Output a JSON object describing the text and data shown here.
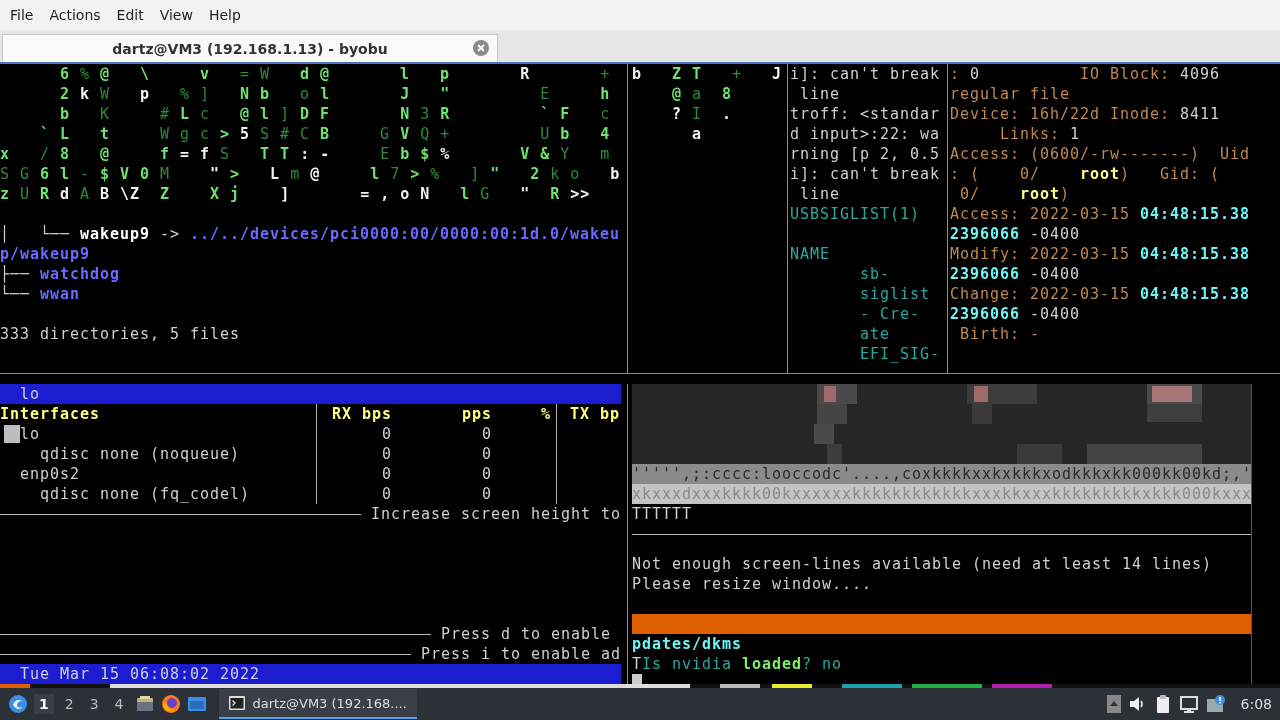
{
  "menu": [
    "File",
    "Actions",
    "Edit",
    "View",
    "Help"
  ],
  "tabs": [
    {
      "label": "dartz@VM3 (192.168.1.13) - byobu",
      "selected": true
    }
  ],
  "top": {
    "matrix_left": [
      [
        {
          "text": "      6",
          "kind": "bright"
        },
        {
          "text": " %",
          "kind": "dim"
        },
        {
          "text": " @",
          "kind": "bright"
        },
        {
          "text": "   \\",
          "kind": "bright"
        },
        {
          "text": "     v",
          "kind": "bright"
        },
        {
          "text": "   = W",
          "kind": "dim"
        },
        {
          "text": "   d @",
          "kind": "bright"
        },
        {
          "text": "       l   p",
          "kind": "bright"
        },
        {
          "text": "       R",
          "kind": "white"
        },
        {
          "text": "       +",
          "kind": "dim"
        }
      ],
      [
        {
          "text": "      2",
          "kind": "bright"
        },
        {
          "text": " k",
          "kind": "white"
        },
        {
          "text": " W",
          "kind": "dim"
        },
        {
          "text": "   p",
          "kind": "white"
        },
        {
          "text": "   %",
          "kind": "dim"
        },
        {
          "text": " ]",
          "kind": "dim"
        },
        {
          "text": "   N b",
          "kind": "bright"
        },
        {
          "text": "   o",
          "kind": "dim"
        },
        {
          "text": " l",
          "kind": "bright"
        },
        {
          "text": "       J   \"",
          "kind": "bright"
        },
        {
          "text": "         E",
          "kind": "dim"
        },
        {
          "text": "     h",
          "kind": "bright"
        }
      ],
      [
        {
          "text": "      b",
          "kind": "bright"
        },
        {
          "text": "   K",
          "kind": "dim"
        },
        {
          "text": "     #",
          "kind": "dim"
        },
        {
          "text": " L",
          "kind": "bright"
        },
        {
          "text": " c",
          "kind": "dim"
        },
        {
          "text": "   @ l",
          "kind": "bright"
        },
        {
          "text": " ]",
          "kind": "dim"
        },
        {
          "text": " D F",
          "kind": "bright"
        },
        {
          "text": "       N",
          "kind": "bright"
        },
        {
          "text": " 3",
          "kind": "dim"
        },
        {
          "text": " R",
          "kind": "bright"
        },
        {
          "text": "         ` F",
          "kind": "bright"
        },
        {
          "text": "   c",
          "kind": "dim"
        }
      ],
      [
        {
          "text": "    ` L",
          "kind": "bright"
        },
        {
          "text": "   t",
          "kind": "bright"
        },
        {
          "text": "     W g c",
          "kind": "dim"
        },
        {
          "text": " >",
          "kind": "bright"
        },
        {
          "text": " 5",
          "kind": "white"
        },
        {
          "text": " S # C",
          "kind": "dim"
        },
        {
          "text": " B",
          "kind": "bright"
        },
        {
          "text": "     G",
          "kind": "dim"
        },
        {
          "text": " V",
          "kind": "bright"
        },
        {
          "text": " Q +",
          "kind": "dim"
        },
        {
          "text": "         U",
          "kind": "dim"
        },
        {
          "text": " b",
          "kind": "bright"
        },
        {
          "text": "   4",
          "kind": "bright"
        }
      ],
      [
        {
          "text": "x",
          "kind": "bright"
        },
        {
          "text": "   /",
          "kind": "dim"
        },
        {
          "text": " 8",
          "kind": "bright"
        },
        {
          "text": "   @",
          "kind": "bright"
        },
        {
          "text": "     f",
          "kind": "bright"
        },
        {
          "text": " = f",
          "kind": "white"
        },
        {
          "text": " S",
          "kind": "dim"
        },
        {
          "text": "   T T",
          "kind": "bright"
        },
        {
          "text": " : -",
          "kind": "white"
        },
        {
          "text": "     E",
          "kind": "dim"
        },
        {
          "text": " b $",
          "kind": "bright"
        },
        {
          "text": " %",
          "kind": "white"
        },
        {
          "text": "       V &",
          "kind": "bright"
        },
        {
          "text": " Y",
          "kind": "dim"
        },
        {
          "text": "   m",
          "kind": "dim"
        }
      ],
      [
        {
          "text": "S G",
          "kind": "dim"
        },
        {
          "text": " 6 l",
          "kind": "bright"
        },
        {
          "text": " -",
          "kind": "dim"
        },
        {
          "text": " $ V 0",
          "kind": "bright"
        },
        {
          "text": " M",
          "kind": "dim"
        },
        {
          "text": "    \"",
          "kind": "white"
        },
        {
          "text": " >",
          "kind": "bright"
        },
        {
          "text": "   L",
          "kind": "white"
        },
        {
          "text": " m",
          "kind": "dim"
        },
        {
          "text": " @",
          "kind": "white"
        },
        {
          "text": "     l",
          "kind": "bright"
        },
        {
          "text": " 7",
          "kind": "dim"
        },
        {
          "text": " >",
          "kind": "bright"
        },
        {
          "text": " %",
          "kind": "dim"
        },
        {
          "text": "   ]",
          "kind": "dim"
        },
        {
          "text": " \"",
          "kind": "bright"
        },
        {
          "text": "   2",
          "kind": "bright"
        },
        {
          "text": " k o",
          "kind": "dim"
        },
        {
          "text": "   b",
          "kind": "white"
        }
      ],
      [
        {
          "text": "z",
          "kind": "bright"
        },
        {
          "text": " U",
          "kind": "dim"
        },
        {
          "text": " R",
          "kind": "bright"
        },
        {
          "text": " d",
          "kind": "white"
        },
        {
          "text": " A",
          "kind": "dim"
        },
        {
          "text": " B \\Z",
          "kind": "white"
        },
        {
          "text": "  Z",
          "kind": "bright"
        },
        {
          "text": "    X j",
          "kind": "bright"
        },
        {
          "text": "    ]",
          "kind": "white"
        },
        {
          "text": "       = , o N",
          "kind": "white"
        },
        {
          "text": "   l",
          "kind": "bright"
        },
        {
          "text": " G",
          "kind": "dim"
        },
        {
          "text": "   \"",
          "kind": "white"
        },
        {
          "text": "  R",
          "kind": "bright"
        },
        {
          "text": " >>",
          "kind": "white"
        }
      ]
    ],
    "tree": [
      [
        [
          {
            "text": "│   └── ",
            "kind": "gray"
          },
          {
            "text": "wakeup9",
            "kind": "bwhite"
          },
          {
            "text": " -> ",
            "kind": "gray"
          },
          {
            "text": "../../devices/pci0000:00/0000:00:1d.0/wakeu",
            "kind": "blue"
          }
        ],
        [
          {
            "text": "p/wakeup9",
            "kind": "blue"
          }
        ],
        [
          {
            "text": "├── ",
            "kind": "gray"
          },
          {
            "text": "watchdog",
            "kind": "blue"
          }
        ],
        [
          {
            "text": "└── ",
            "kind": "gray"
          },
          {
            "text": "wwan",
            "kind": "blue"
          }
        ]
      ],
      [
        [
          {
            "text": "333 directories, 5 files",
            "kind": "gray"
          }
        ]
      ]
    ],
    "matrix_right": [
      [
        {
          "text": "b",
          "kind": "white"
        },
        {
          "text": "   Z T",
          "kind": "bright"
        },
        {
          "text": "   +",
          "kind": "dim"
        },
        {
          "text": "   J",
          "kind": "white"
        }
      ],
      [
        {
          "text": "    @",
          "kind": "bright"
        },
        {
          "text": " a",
          "kind": "dim"
        },
        {
          "text": "  8",
          "kind": "bright"
        }
      ],
      [
        {
          "text": "    ?",
          "kind": "white"
        },
        {
          "text": " I",
          "kind": "dim"
        },
        {
          "text": "  .",
          "kind": "white"
        }
      ],
      [
        {
          "text": "      a",
          "kind": "white"
        }
      ]
    ],
    "man_page": [
      [
        [
          {
            "text": "i]: can't break",
            "kind": "gray"
          }
        ],
        [
          {
            "text": " line",
            "kind": "gray"
          }
        ],
        [
          {
            "text": "troff: <standar",
            "kind": "gray"
          }
        ],
        [
          {
            "text": "d input>:22: wa",
            "kind": "gray"
          }
        ],
        [
          {
            "text": "rning [p 2, 0.5",
            "kind": "gray"
          }
        ],
        [
          {
            "text": "i]: can't break",
            "kind": "gray"
          }
        ],
        [
          {
            "text": " line",
            "kind": "gray"
          }
        ],
        [
          {
            "text": "USBSIGLIST(1)",
            "kind": "teal"
          }
        ]
      ],
      [
        [
          {
            "text": "NAME",
            "kind": "teal"
          }
        ],
        [
          {
            "text": "       sb-",
            "kind": "teal"
          }
        ],
        [
          {
            "text": "       siglist",
            "kind": "teal"
          }
        ],
        [
          {
            "text": "       - Cre-",
            "kind": "teal"
          }
        ],
        [
          {
            "text": "       ate",
            "kind": "teal"
          }
        ],
        [
          {
            "text": "       EFI_SIG-",
            "kind": "teal"
          }
        ]
      ]
    ],
    "file_stat": [
      [
        {
          "text": ": ",
          "kind": "tan"
        },
        {
          "text": "0",
          "kind": "gray"
        },
        {
          "text": "          IO Block: ",
          "kind": "tan"
        },
        {
          "text": "4096",
          "kind": "gray"
        }
      ],
      [
        {
          "text": "regular file",
          "kind": "tan"
        }
      ],
      [
        {
          "text": "Device: 16h/22d Inode: ",
          "kind": "tan"
        },
        {
          "text": "8411",
          "kind": "gray"
        }
      ],
      [
        {
          "text": "     Links: ",
          "kind": "tan"
        },
        {
          "text": "1",
          "kind": "gray"
        }
      ],
      [
        {
          "text": "Access: (0600/-rw-------)  Uid",
          "kind": "tan"
        }
      ],
      [
        {
          "text": ": (    0/    ",
          "kind": "tan"
        },
        {
          "text": "root",
          "kind": "yellow"
        },
        {
          "text": ")   Gid: (",
          "kind": "tan"
        }
      ],
      [
        {
          "text": " 0/    ",
          "kind": "tan"
        },
        {
          "text": "root",
          "kind": "yellow"
        },
        {
          "text": ")",
          "kind": "tan"
        }
      ],
      [
        {
          "text": "Access: 2022-03-15 ",
          "kind": "tan"
        },
        {
          "text": "04:48:15.38",
          "kind": "cyan"
        }
      ],
      [
        {
          "text": "2396066",
          "kind": "cyan"
        },
        {
          "text": " -0400",
          "kind": "gray"
        }
      ],
      [
        {
          "text": "Modify: 2022-03-15 ",
          "kind": "tan"
        },
        {
          "text": "04:48:15.38",
          "kind": "cyan"
        }
      ],
      [
        {
          "text": "2396066",
          "kind": "cyan"
        },
        {
          "text": " -0400",
          "kind": "gray"
        }
      ],
      [
        {
          "text": "Change: 2022-03-15 ",
          "kind": "tan"
        },
        {
          "text": "04:48:15.38",
          "kind": "cyan"
        }
      ],
      [
        {
          "text": "2396066",
          "kind": "cyan"
        },
        {
          "text": " -0400",
          "kind": "gray"
        }
      ],
      [
        {
          "text": " Birth: -",
          "kind": "tan"
        }
      ]
    ]
  },
  "bmon": {
    "title": "lo",
    "columns": [
      "Interfaces",
      "RX bps",
      "pps",
      "%",
      "TX bp"
    ],
    "interfaces": [
      {
        "name": "lo",
        "selected": true,
        "rx": "0",
        "pps": "0",
        "children": [
          {
            "name": "qdisc none (noqueue)",
            "selected": false,
            "rx": "0",
            "pps": "0"
          }
        ]
      },
      {
        "name": "enp0s2",
        "selected": false,
        "rx": "0",
        "pps": "0",
        "children": [
          {
            "name": "qdisc none (fq_codel)",
            "selected": false,
            "rx": "0",
            "pps": "0"
          }
        ]
      }
    ],
    "hints": [
      "Increase screen height to",
      "Press d to enable ",
      "Press i to enable ad"
    ],
    "clock": "Tue Mar 15 06:08:02 2022"
  },
  "preview": {
    "art_lines": [
      "''''',;:cccc:looccodc'....,coxkkkkxxkxkkkxodkkkxkk000kk00kd;,'",
      "xkxxxdxxxkkkk00kxxxxxxkkkkkkkkkkkkxxxkkxxxkkkkkkkkkxkkk000kxxx"
    ],
    "text": "TTTTTT",
    "messages": [
      "Not enough screen-lines available (need at least 14 lines)",
      "Please resize window...."
    ],
    "output_lines": [
      [
        {
          "text": "pdates/dkms",
          "kind": "cyan"
        }
      ],
      [
        {
          "text": "T",
          "kind": "gray"
        },
        {
          "text": "Is nvidia ",
          "kind": "teal"
        },
        {
          "text": "loaded",
          "kind": "green"
        },
        {
          "text": "? no",
          "kind": "teal"
        }
      ]
    ]
  },
  "taskbar": {
    "workspaces": [
      {
        "label": "1",
        "selected": true
      },
      {
        "label": "2",
        "selected": false
      },
      {
        "label": "3",
        "selected": false
      },
      {
        "label": "4",
        "selected": false
      }
    ],
    "window_button": "dartz@VM3 (192.168....",
    "clock": "6:08"
  }
}
